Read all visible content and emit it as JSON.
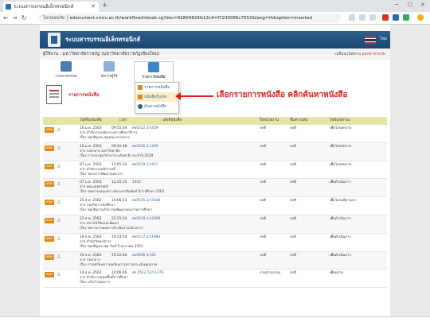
{
  "browser": {
    "tab_title": "ระบบสารบรรณอิเล็กทรอนิกส์",
    "url_prefix": "ไม่ปลอดภัย",
    "url": "edocument.cmru.ac.th/workflow/inbook.cg?doc=92804829&12c4=f7230066c7552&lang=th&option=inserted"
  },
  "site": {
    "title": "ระบบสารบรรณอิเล็กทรอนิกส์",
    "lang_label": "ไทย",
    "breadcrumb": "ผู้ใช้งาน : มหาวิทยาลัยราชภัฏ (มหาวิทยาลัยราชภัฏเชียงใหม่)",
    "user_label": "เปลี่ยนรหัสผ่าน",
    "logout_label": "ออกจากระบบ"
  },
  "modules": [
    {
      "label": "งานสารบรรณ",
      "active": false
    },
    {
      "label": "จัดการผู้ใช้",
      "active": false
    },
    {
      "label": "รายการหนังสือ",
      "active": true
    }
  ],
  "section_title": "รายการหนังสือ",
  "submenu": [
    {
      "label": "รายการหนังสือ",
      "color": "#d98a1b"
    },
    {
      "label": "หนังสือรับ/ส่ง",
      "color": "#d98a1b"
    },
    {
      "label": "ค้นหาหนังสือ",
      "color": "#2d5f8e"
    }
  ],
  "annotation": "เลือกรายการหนังสือ คลิกค้นหาหนังสือ",
  "table": {
    "headers": [
      "วันที่รับหนังสือ",
      "เวลา",
      "เลขที่หนังสือ",
      "ถึงหน่วยงาน",
      "ชั้นความลับ",
      "ไขข้อ/สถานะ"
    ],
    "rows": [
      {
        "date": "10 ม.ค. 2563",
        "time": "09:55:34",
        "num": "ศธ0522.2/ว459",
        "to": "ปกติ",
        "from": "ปกติ",
        "status": "เพื่อโปรดทราบ",
        "l2": "จาก สำนักงานปลัดกระทรวงศึกษาธิการ",
        "l3": "เรื่อง ขอเชิญประชุมคณะกรรมการ"
      },
      {
        "date": "10 ม.ค. 2563",
        "time": "09:41:48",
        "num": "ศธ0226.5/ว200",
        "to": "ปกติ",
        "from": "ปกติ",
        "status": "เพื่อโปรดทราบ",
        "l2": "จาก กองกลาง มหาวิทยาลัย",
        "l3": "เรื่อง การประชุมวิชาการระดับชาติ ประจำปี 2019"
      },
      {
        "date": "07 ม.ค. 2563",
        "time": "13:05:34",
        "num": "ศธ0519.1/ว421",
        "to": "ปกติ",
        "from": "ปกติ",
        "status": "เพื่อโปรดทราบ",
        "l2": "จาก สำนักงานอธิการบดี",
        "l3": "เรื่อง โครงการพัฒนาบุคลากร"
      },
      {
        "date": "07 ม.ค. 2563",
        "time": "12:45:15",
        "num": "1402",
        "to": "ปกติ",
        "from": "ปกติ",
        "status": "เพื่อดำเนินการ",
        "l2": "จาก คณะครุศาสตร์",
        "l3": "เรื่อง ขอความอนุเคราะห์ประชาสัมพันธ์ ปีการศึกษา 2562"
      },
      {
        "date": "25 ธ.ค. 2562",
        "time": "10:06:23",
        "num": "ศธ0535.2/ว5408",
        "to": "ปกติ",
        "from": "ปกติ",
        "status": "เพื่อโปรดพิจารณา",
        "l2": "จาก กองกิจการนักศึกษา",
        "l3": "เรื่อง ขอเชิญร่วมกิจกรรมพัฒนาคุณภาพการศึกษา"
      },
      {
        "date": "22 ธ.ค. 2562",
        "time": "22:25:24",
        "num": "ศธ0519.1/ว2909",
        "to": "ปกติ",
        "from": "ปกติ",
        "status": "เพื่อดำเนินการ",
        "l2": "จาก สถาบันวิจัยและพัฒนา",
        "l3": "เรื่อง ขอรายงานผลการดำเนินงานโครงการ"
      },
      {
        "date": "19 ธ.ค. 2562",
        "time": "19:23:54",
        "num": "ศธ0517.2/ว1984",
        "to": "ปกติ",
        "from": "ปกติ",
        "status": "เพื่อดำเนินการ",
        "l2": "จาก สำนักวิทยบริการ",
        "l3": "เรื่อง ขอเชิญประชุม วันที่ 9 มกราคม 2563"
      },
      {
        "date": "19 ธ.ค. 2562",
        "time": "19:22:40",
        "num": "ศธ0606.3/ว85",
        "to": "ปกติ",
        "from": "ปกติ",
        "status": "เพื่อดำเนินการ",
        "l2": "จาก กองกลาง",
        "l3": "เรื่อง การเตรียมความพร้อมการตรวจประเมินคุณภาพ"
      },
      {
        "date": "14 ธ.ค. 2562",
        "time": "10:06:46",
        "num": "ศธ 0512.51/ว1379",
        "to": "งานสารบรรณ",
        "from": "ปกติ",
        "status": "เพื่อทราบ",
        "l2": "จาก สำนักงานเขตพื้นที่การศึกษา",
        "l3": "เรื่อง แจ้งกำหนดการ"
      }
    ]
  },
  "colors": {
    "header_bg": "#1d4670",
    "table_header_bg": "#e5e5a8",
    "badge": "#e08a12",
    "annotation": "#e02020"
  }
}
